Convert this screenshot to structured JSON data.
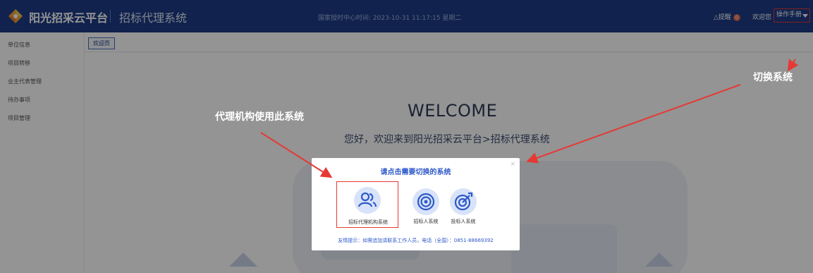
{
  "header": {
    "brand": "阳光招采云平台",
    "system_title": "招标代理系统",
    "server_time": "国家授时中心时间: 2023-10-31 11:17:15 星期二",
    "reminder_label": "提醒",
    "reminder_count": "0",
    "welcome_user": "欢迎您",
    "manual_button": "操作手册"
  },
  "sidebar": {
    "items": [
      {
        "label": "单位信息"
      },
      {
        "label": "项目转移"
      },
      {
        "label": "业主代表管理"
      },
      {
        "label": "待办事项"
      },
      {
        "label": "项目管理"
      }
    ]
  },
  "tabs": [
    {
      "label": "欢迎页"
    }
  ],
  "main": {
    "welcome_title": "WELCOME",
    "welcome_subtitle": "您好，欢迎来到阳光招采云平台>招标代理系统"
  },
  "modal": {
    "title": "请点击需要切换的系统",
    "close": "×",
    "options": [
      {
        "label": "招标代理机构系统",
        "icon": "users-icon",
        "selected": true
      },
      {
        "label": "招标人系统",
        "icon": "target-icon",
        "selected": false
      },
      {
        "label": "投标人系统",
        "icon": "target-arrow-icon",
        "selected": false
      }
    ],
    "tip": "友情提示：如需追加请联系工作人员，电话（全国）：0851-88669392"
  },
  "annotations": {
    "switch_system": "切换系统",
    "agency_hint": "代理机构使用此系统"
  },
  "colors": {
    "header_bg": "#1c3b86",
    "accent_blue": "#2d58c8",
    "highlight_red": "#e53935",
    "icon_bg": "#d8e3f9"
  }
}
